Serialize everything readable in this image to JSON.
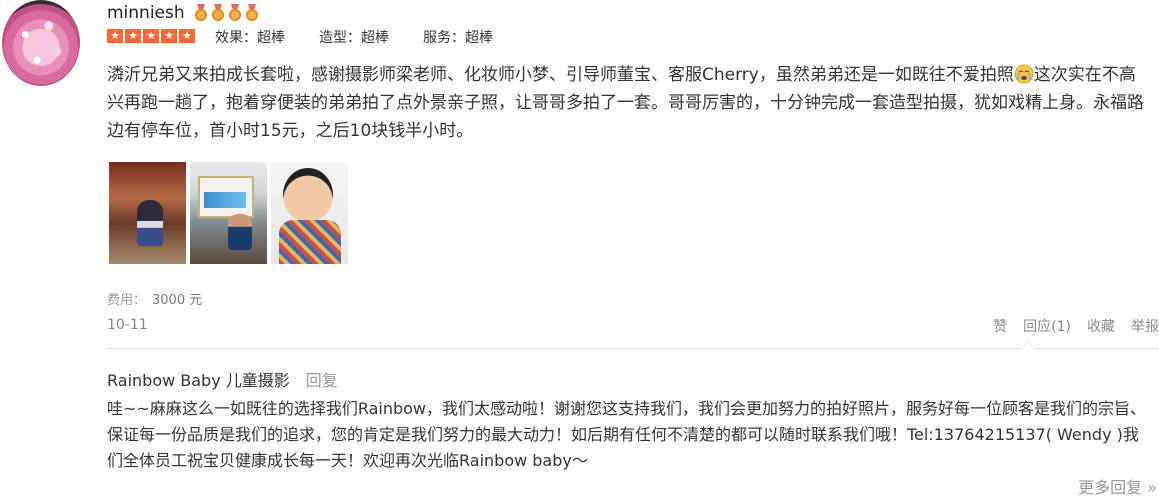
{
  "review": {
    "username": "minniesh",
    "stars": 5,
    "ratings": [
      {
        "label": "效果：超棒"
      },
      {
        "label": "造型：超棒"
      },
      {
        "label": "服务：超棒"
      }
    ],
    "text_before_emoji": "潾沂兄弟又来拍成长套啦，感谢摄影师梁老师、化妆师小梦、引导师董宝、客服Cherry，虽然弟弟还是一如既往不爱拍照",
    "text_after_emoji": "这次实在不高兴再跑一趟了，抱着穿便装的弟弟拍了点外景亲子照，让哥哥多拍了一套。哥哥厉害的，十分钟完成一套造型拍摄，犹如戏精上身。永福路边有停车位，首小时15元，之后10块钱半小时。",
    "emoji_icon": "crying-face-icon",
    "cost_label": "费用：",
    "cost_value": "3000 元",
    "date": "10-11",
    "actions": {
      "like": "赞",
      "reply": "回应(1)",
      "favorite": "收藏",
      "report": "举报"
    }
  },
  "merchant_reply": {
    "name": "Rainbow Baby 儿童摄影",
    "tag": "回复",
    "text": "哇~~麻麻这么一如既往的选择我们Rainbow，我们太感动啦！谢谢您这支持我们，我们会更加努力的拍好照片，服务好每一位顾客是我们的宗旨、保证每一份品质是我们的追求，您的肯定是我们努力的最大动力！如后期有任何不清楚的都可以随时联系我们哦！Tel:13764215137( Wendy )我们全体员工祝宝贝健康成长每一天！欢迎再次光临Rainbow baby～"
  },
  "more_replies": "更多回复 »",
  "colors": {
    "star": "#ff6633",
    "muted": "#999999",
    "text": "#333333"
  }
}
